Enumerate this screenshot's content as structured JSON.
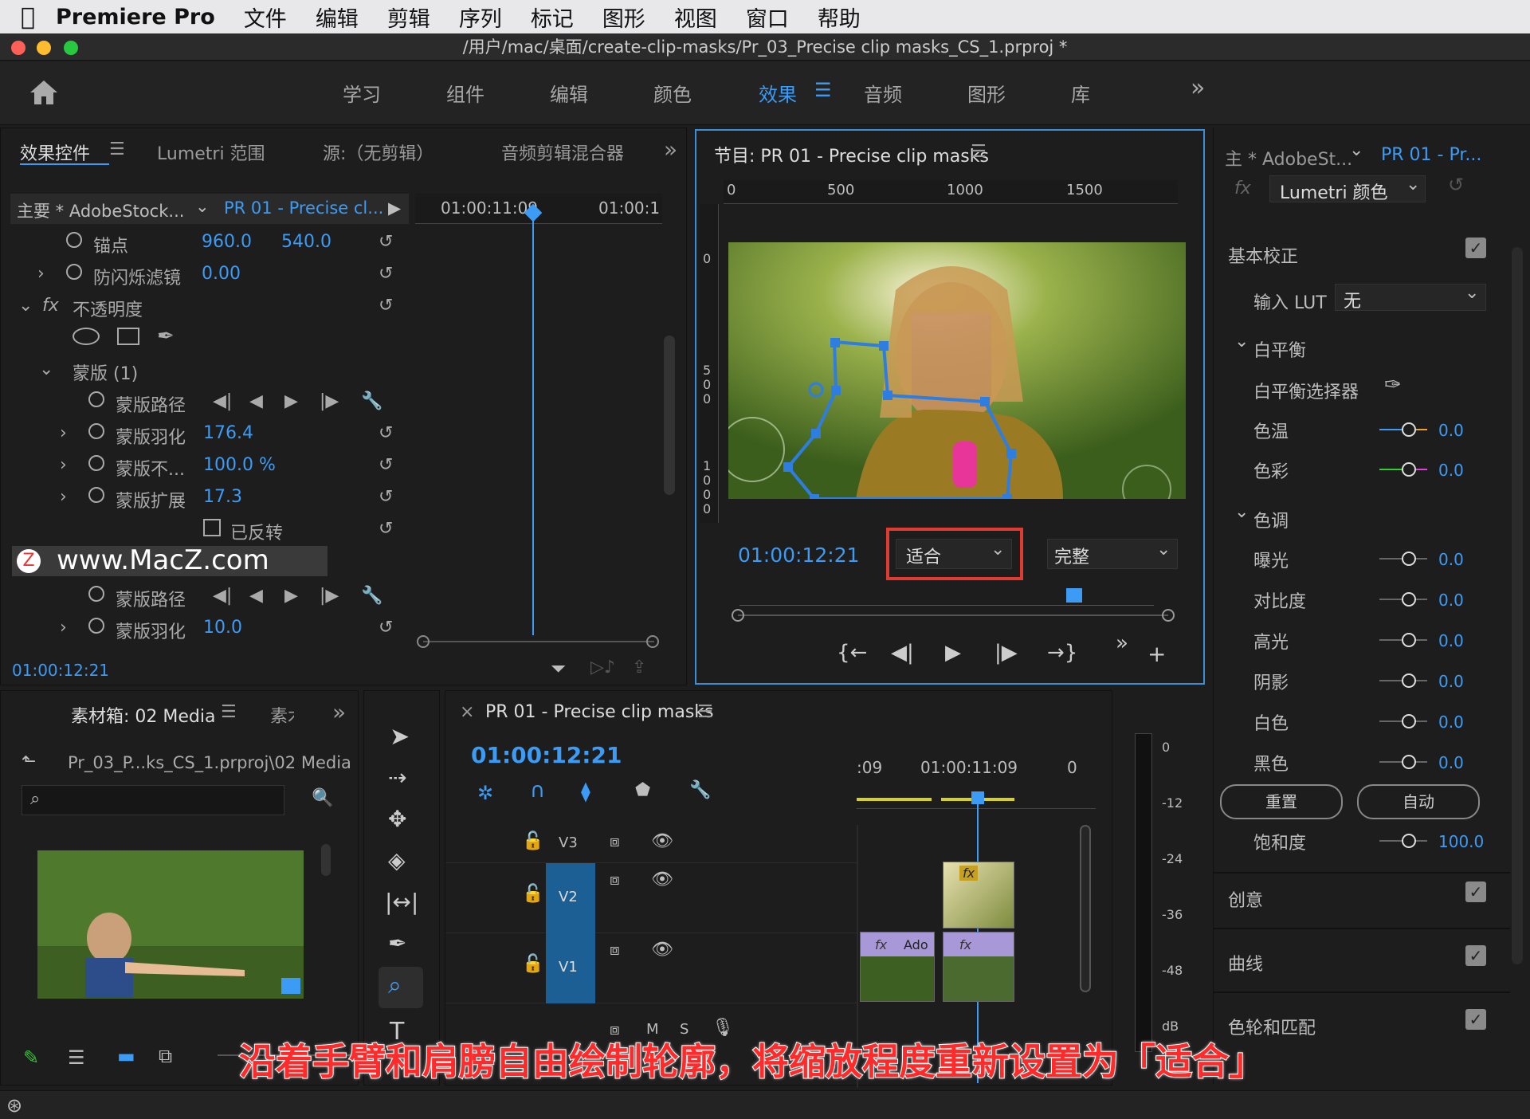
{
  "menubar": {
    "app": "Premiere Pro",
    "items": [
      "文件",
      "编辑",
      "剪辑",
      "序列",
      "标记",
      "图形",
      "视图",
      "窗口",
      "帮助"
    ]
  },
  "window": {
    "title": "/用户/mac/桌面/create-clip-masks/Pr_03_Precise clip masks_CS_1.prproj *"
  },
  "workspaces": {
    "items": [
      "学习",
      "组件",
      "编辑",
      "颜色",
      "效果",
      "音频",
      "图形",
      "库"
    ],
    "active": "效果",
    "more": "»"
  },
  "effect_controls": {
    "tabs": [
      "效果控件",
      "Lumetri 范围",
      "源:（无剪辑）",
      "音频剪辑混合器"
    ],
    "header_master": "主要 * AdobeStock...",
    "header_seq": "PR 01 - Precise cl...",
    "ruler": [
      "01:00:11:09",
      "01:00:1"
    ],
    "rows": [
      {
        "label": "锚点",
        "v1": "960.0",
        "v2": "540.0"
      },
      {
        "label": "防闪烁滤镜",
        "v1": "0.00"
      },
      {
        "label": "不透明度"
      },
      {
        "label": "蒙版 (1)"
      },
      {
        "label": "蒙版路径"
      },
      {
        "label": "蒙版羽化",
        "v1": "176.4"
      },
      {
        "label": "蒙版不...",
        "v1": "100.0 %"
      },
      {
        "label": "蒙版扩展",
        "v1": "17.3"
      },
      {
        "label": "已反转"
      },
      {
        "label": "蒙版路径"
      },
      {
        "label": "蒙版羽化",
        "v1": "10.0"
      }
    ],
    "timecode": "01:00:12:21",
    "watermark": "www.MacZ.com"
  },
  "program": {
    "title": "节目: PR 01 - Precise clip masks",
    "ruler": [
      "0",
      "500",
      "1000",
      "1500"
    ],
    "vruler": [
      "0",
      "5\n0\n0",
      "1\n0\n0\n0"
    ],
    "timecode": "01:00:12:21",
    "zoom": "适合",
    "quality": "完整"
  },
  "lumetri": {
    "master": "主 * AdobeSt...",
    "seq": "PR 01 - Pr...",
    "effect": "Lumetri 颜色",
    "basic": "基本校正",
    "input_lut_label": "输入 LUT",
    "input_lut": "无",
    "wb": "白平衡",
    "wb_selector": "白平衡选择器",
    "temp": {
      "label": "色温",
      "val": "0.0"
    },
    "tint": {
      "label": "色彩",
      "val": "0.0"
    },
    "tone": "色调",
    "tones": [
      {
        "label": "曝光",
        "val": "0.0"
      },
      {
        "label": "对比度",
        "val": "0.0"
      },
      {
        "label": "高光",
        "val": "0.0"
      },
      {
        "label": "阴影",
        "val": "0.0"
      },
      {
        "label": "白色",
        "val": "0.0"
      },
      {
        "label": "黑色",
        "val": "0.0"
      }
    ],
    "reset": "重置",
    "auto": "自动",
    "saturation": {
      "label": "饱和度",
      "val": "100.0"
    },
    "sections": [
      "创意",
      "曲线",
      "色轮和匹配"
    ]
  },
  "project": {
    "tab": "素材箱: 02 Media",
    "tab2": "素木",
    "path": "Pr_03_P...ks_CS_1.prproj\\02 Media"
  },
  "timeline": {
    "title": "PR 01 - Precise clip masks",
    "timecode": "01:00:12:21",
    "ruler": [
      ":09",
      "01:00:11:09",
      "0"
    ],
    "tracks": [
      "V3",
      "V2",
      "V1"
    ],
    "clip_label": "Ado",
    "meter": [
      "0",
      "-12",
      "-24",
      "-36",
      "-48",
      "dB"
    ]
  },
  "caption": "沿着手臂和肩膀自由绘制轮廓，将缩放程度重新设置为「适合」"
}
